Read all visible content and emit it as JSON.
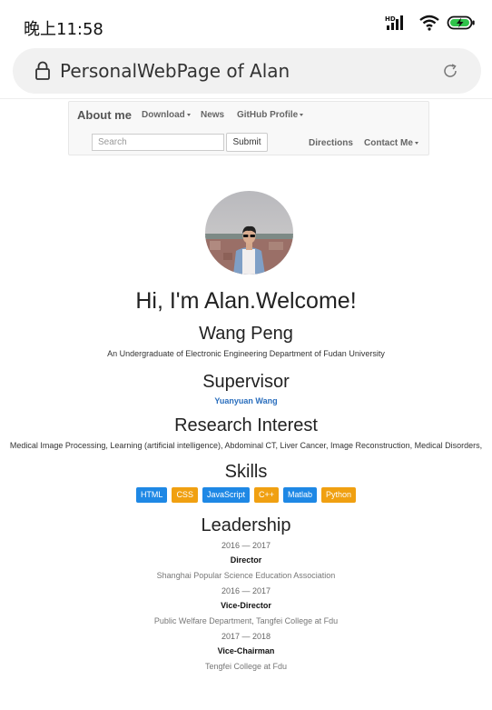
{
  "status_bar": {
    "time": "晚上11:58",
    "signal_label": "HD"
  },
  "browser": {
    "address": "PersonalWebPage of Alan"
  },
  "navbar": {
    "brand": "About me",
    "links": [
      "Download",
      "News",
      "GitHub Profile"
    ],
    "search_placeholder": "Search",
    "submit_label": "Submit",
    "directions_label": "Directions",
    "contact_label": "Contact Me"
  },
  "profile": {
    "greeting": "Hi, I'm Alan.Welcome!",
    "name": "Wang Peng",
    "description": "An Undergraduate of Electronic Engineering Department of Fudan University"
  },
  "supervisor": {
    "title": "Supervisor",
    "name": "Yuanyuan Wang"
  },
  "research": {
    "title": "Research Interest",
    "text": "Medical Image Processing, Learning (artificial intelligence), Abdominal CT, Liver Cancer, Image Reconstruction, Medical Disorders,"
  },
  "skills": {
    "title": "Skills",
    "items": [
      {
        "label": "HTML",
        "color": "#1e88e5"
      },
      {
        "label": "CSS",
        "color": "#f0a011"
      },
      {
        "label": "JavaScript",
        "color": "#1e88e5"
      },
      {
        "label": "C++",
        "color": "#f0a011"
      },
      {
        "label": "Matlab",
        "color": "#1e88e5"
      },
      {
        "label": "Python",
        "color": "#f0a011"
      }
    ]
  },
  "leadership": {
    "title": "Leadership",
    "entries": [
      {
        "years": "2016 — 2017",
        "role": "Director",
        "org": "Shanghai Popular Science Education Association"
      },
      {
        "years": "2016 — 2017",
        "role": "Vice-Director",
        "org": "Public Welfare Department, Tangfei College at Fdu"
      },
      {
        "years": "2017 — 2018",
        "role": "Vice-Chairman",
        "org": "Tengfei College at Fdu"
      }
    ]
  }
}
